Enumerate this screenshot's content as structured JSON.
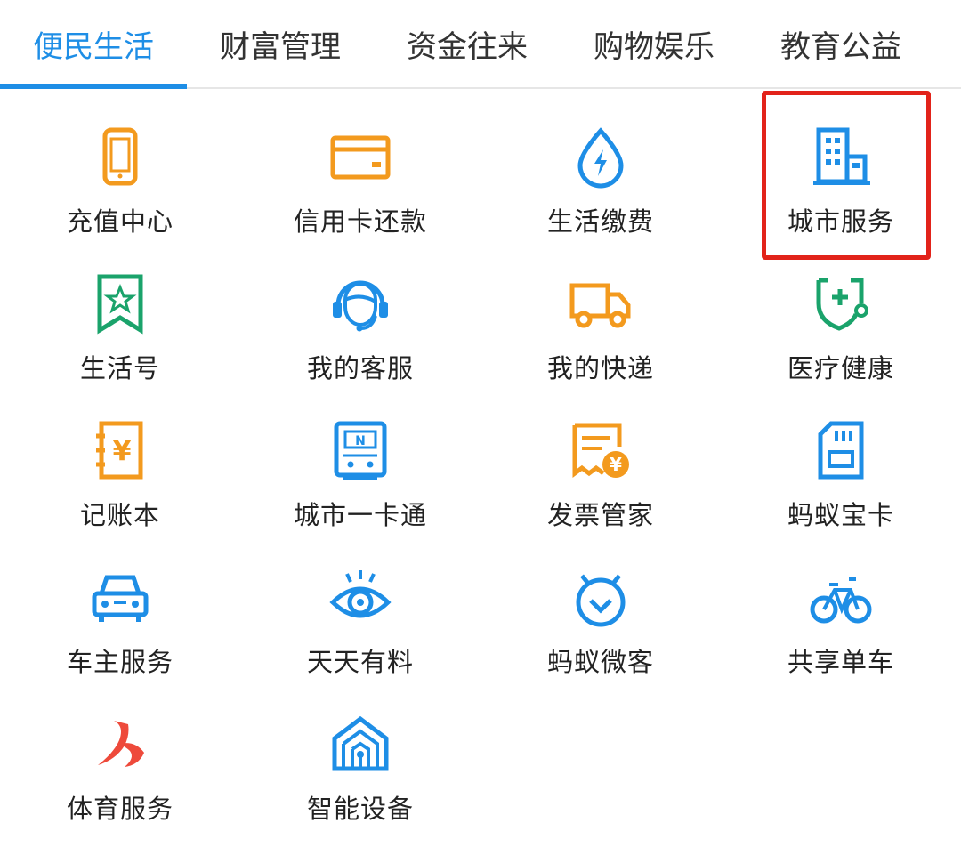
{
  "tabs": [
    "便民生活",
    "财富管理",
    "资金往来",
    "购物娱乐",
    "教育公益"
  ],
  "active_tab": "便民生活",
  "colors": {
    "accent": "#1e8ee6",
    "orange": "#f39a1e",
    "green": "#1aa36b",
    "red": "#e2231a",
    "red_icon": "#ee4a3b"
  },
  "services": [
    {
      "label": "充值中心",
      "icon": "phone-icon"
    },
    {
      "label": "信用卡还款",
      "icon": "credit-card-icon"
    },
    {
      "label": "生活缴费",
      "icon": "water-drop-bolt-icon"
    },
    {
      "label": "城市服务",
      "icon": "building-icon"
    },
    {
      "label": "生活号",
      "icon": "bookmark-star-icon"
    },
    {
      "label": "我的客服",
      "icon": "headset-icon"
    },
    {
      "label": "我的快递",
      "icon": "truck-icon"
    },
    {
      "label": "医疗健康",
      "icon": "stethoscope-shield-icon"
    },
    {
      "label": "记账本",
      "icon": "yuan-notebook-icon"
    },
    {
      "label": "城市一卡通",
      "icon": "transit-card-icon"
    },
    {
      "label": "发票管家",
      "icon": "invoice-icon"
    },
    {
      "label": "蚂蚁宝卡",
      "icon": "sim-card-icon"
    },
    {
      "label": "车主服务",
      "icon": "car-icon"
    },
    {
      "label": "天天有料",
      "icon": "eye-icon"
    },
    {
      "label": "蚂蚁微客",
      "icon": "ant-face-icon"
    },
    {
      "label": "共享单车",
      "icon": "bicycle-icon"
    },
    {
      "label": "体育服务",
      "icon": "sports-logo-icon"
    },
    {
      "label": "智能设备",
      "icon": "smart-home-icon"
    }
  ]
}
